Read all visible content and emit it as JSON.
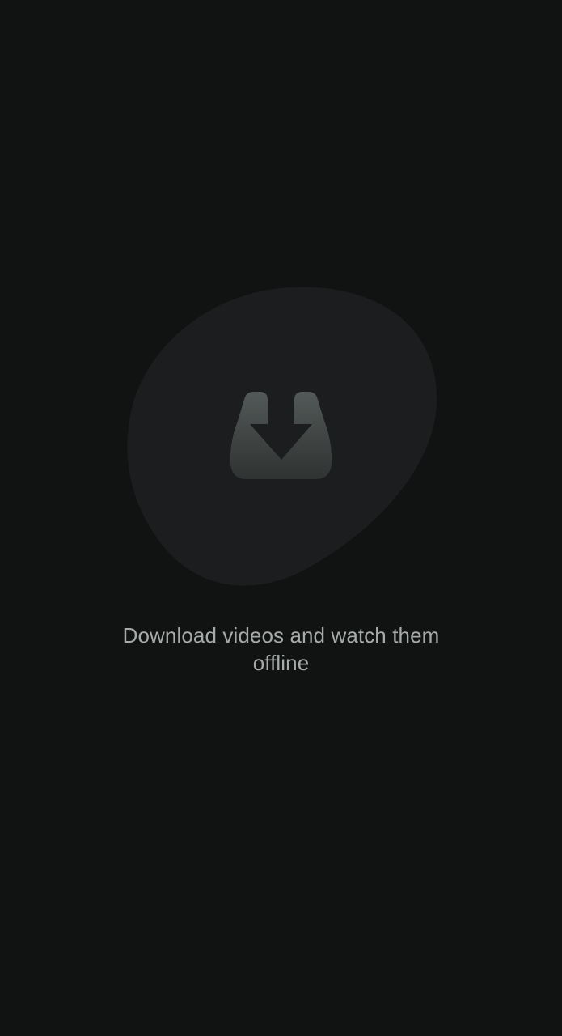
{
  "empty_state": {
    "icon": "download-tray-icon",
    "message": "Download videos and watch them offline"
  },
  "colors": {
    "background": "#111313",
    "blob": "#1b1d1e",
    "icon_top": "#4f5554",
    "icon_bottom": "#2e3231",
    "message_text": "#a6aaa9"
  }
}
